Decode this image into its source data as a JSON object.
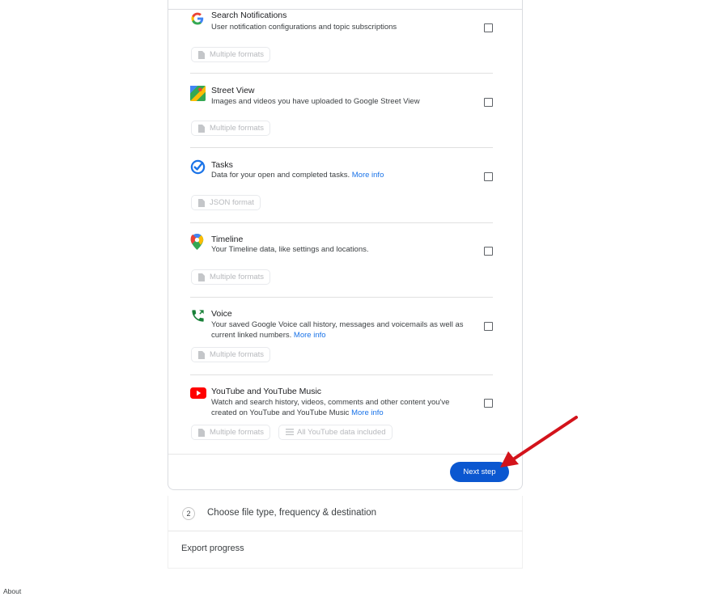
{
  "products": [
    {
      "title": "Search Notifications",
      "description": "User notification configurations and topic subscriptions",
      "link": "",
      "formats": [
        "Multiple formats"
      ],
      "icon": "google-g-icon"
    },
    {
      "title": "Street View",
      "description": "Images and videos you have uploaded to Google Street View",
      "link": "",
      "formats": [
        "Multiple formats"
      ],
      "icon": "street-view-icon"
    },
    {
      "title": "Tasks",
      "description": "Data for your open and completed tasks.",
      "link": "More info",
      "formats": [
        "JSON format"
      ],
      "icon": "tasks-icon"
    },
    {
      "title": "Timeline",
      "description": "Your Timeline data, like settings and locations.",
      "link": "",
      "formats": [
        "Multiple formats"
      ],
      "icon": "maps-pin-icon"
    },
    {
      "title": "Voice",
      "description": "Your saved Google Voice call history, messages and voicemails as well as current linked numbers.",
      "link": "More info",
      "formats": [
        "Multiple formats"
      ],
      "icon": "voice-phone-icon"
    },
    {
      "title": "YouTube and YouTube Music",
      "description": "Watch and search history, videos, comments and other content you've created on YouTube and YouTube Music",
      "link": "More info",
      "formats": [
        "Multiple formats",
        "All YouTube data included"
      ],
      "icon": "youtube-icon"
    }
  ],
  "next_button": "Next step",
  "step2": {
    "number": "2",
    "label": "Choose file type, frequency & destination"
  },
  "export_progress": "Export progress",
  "footer": {
    "about": "About"
  },
  "colors": {
    "accent": "#0b57d0",
    "link": "#1a73e8",
    "annotation_arrow": "#d3131b"
  }
}
